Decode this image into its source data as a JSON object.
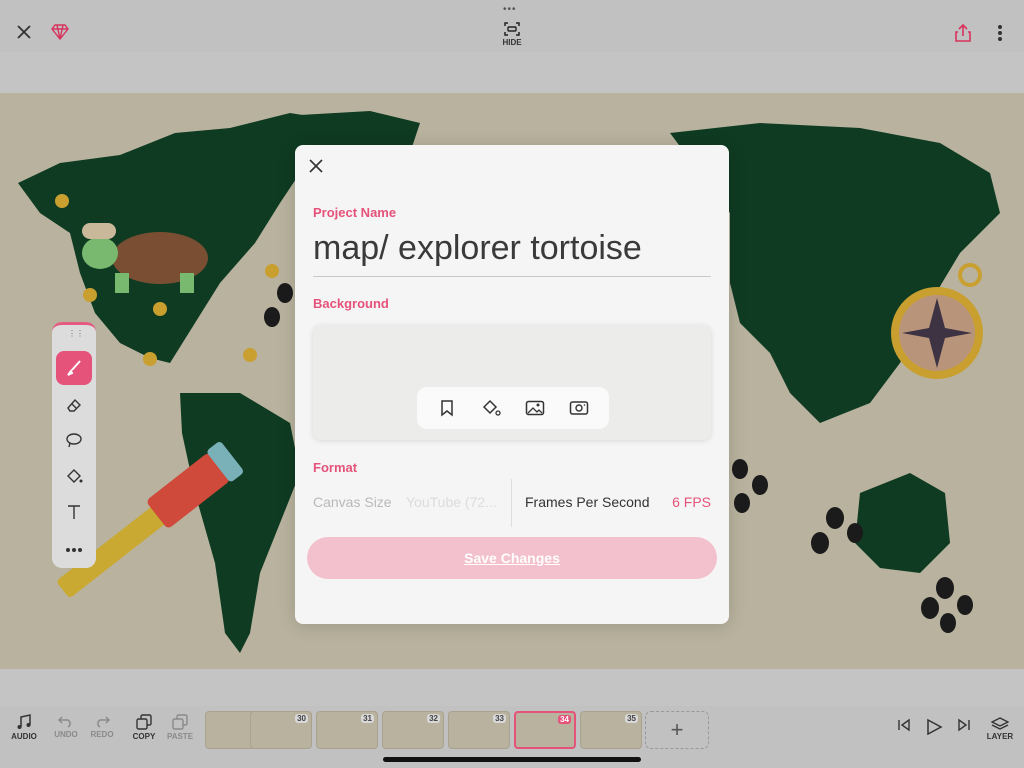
{
  "topbar": {
    "drag_handle": "•••",
    "hide_label": "HIDE",
    "icons": [
      "close-icon",
      "gem-icon",
      "hide-icon",
      "share-icon",
      "more-vertical-icon"
    ]
  },
  "tools": [
    "brush-icon",
    "eraser-icon",
    "lasso-icon",
    "fill-icon",
    "text-icon",
    "more-icon"
  ],
  "modal": {
    "project_name_label": "Project Name",
    "project_name": "map/ explorer tortoise",
    "background_label": "Background",
    "background_tools": [
      "bookmark-icon",
      "paint-bucket-icon",
      "image-icon",
      "camera-icon"
    ],
    "format_label": "Format",
    "canvas_size_label": "Canvas Size",
    "canvas_size_value": "YouTube (72...",
    "fps_label": "Frames Per Second",
    "fps_value": "6 FPS",
    "save_label": "Save Changes"
  },
  "bottombar": {
    "audio": "AUDIO",
    "undo": "UNDO",
    "redo": "REDO",
    "copy": "COPY",
    "paste": "PASTE",
    "layer": "LAYER",
    "frames": [
      "29",
      "30",
      "31",
      "32",
      "33",
      "34",
      "35"
    ],
    "selected_frame": "34",
    "add_frame": "+"
  },
  "colors": {
    "accent": "#e5527a",
    "map_land": "#0f3b22",
    "canvas_bg": "#b8b29e"
  }
}
